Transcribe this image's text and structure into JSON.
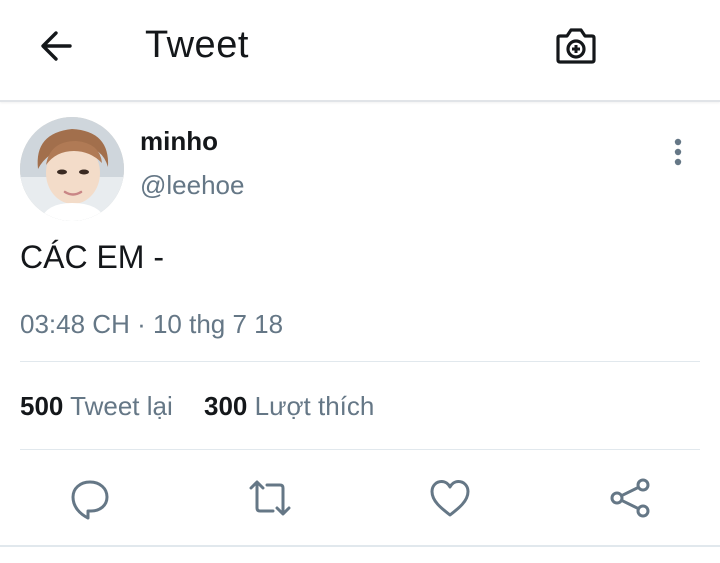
{
  "header": {
    "title": "Tweet",
    "back_icon": "arrow-left-icon",
    "camera_icon": "camera-plus-icon"
  },
  "tweet": {
    "author": {
      "display_name": "minho",
      "handle": "@leehoe"
    },
    "text": "CÁC EM -",
    "timestamp": "03:48 CH · 10 thg 7 18",
    "stats": {
      "retweets_count": "500",
      "retweets_label": "Tweet lại",
      "likes_count": "300",
      "likes_label": "Lượt thích"
    }
  },
  "actions": [
    {
      "name": "reply",
      "icon": "reply-icon"
    },
    {
      "name": "retweet",
      "icon": "retweet-icon"
    },
    {
      "name": "like",
      "icon": "heart-icon"
    },
    {
      "name": "share",
      "icon": "share-icon"
    }
  ],
  "colors": {
    "text_primary": "#14171a",
    "text_secondary": "#657786",
    "icon": "#657786",
    "divider": "#e1e8ed"
  }
}
